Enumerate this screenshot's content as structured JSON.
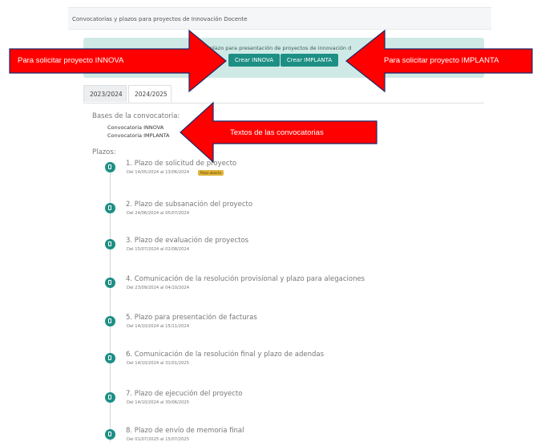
{
  "header": {
    "title": "Convocatorias y plazos para proyectos de Innovación Docente"
  },
  "notice": {
    "text": "el plazo para presentación de proyectos de innovación d",
    "btn_innova": "Crear INNOVA",
    "btn_implanta": "Crear IMPLANTA"
  },
  "tabs": [
    {
      "label": "2023/2024"
    },
    {
      "label": "2024/2025"
    }
  ],
  "bases": {
    "label": "Bases de la convocatoria:",
    "links": [
      "Convocatoria INNOVA",
      "Convocatoria IMPLANTA"
    ]
  },
  "plazos": {
    "label": "Plazos:",
    "badge": "Plazo abierto",
    "steps": [
      {
        "title": "1. Plazo de solicitud de proyecto",
        "dates": "Del 14/05/2024 al 13/06/2024"
      },
      {
        "title": "2. Plazo de subsanación del proyecto",
        "dates": "Del 24/06/2024 al 05/07/2024"
      },
      {
        "title": "3. Plazo de evaluación de proyectos",
        "dates": "Del 15/07/2024 al 02/08/2024"
      },
      {
        "title": "4. Comunicación de la resolución provisional y plazo para alegaciones",
        "dates": "Del 23/09/2024 al 04/10/2024"
      },
      {
        "title": "5. Plazo para presentación de facturas",
        "dates": "Del 14/10/2024 al 15/11/2024"
      },
      {
        "title": "6. Comunicación de la resolución final y plazo de adendas",
        "dates": "Del 14/10/2024 al 31/01/2025"
      },
      {
        "title": "7. Plazo de ejecución del proyecto",
        "dates": "Del 14/10/2024 al 30/06/2025"
      },
      {
        "title": "8. Plazo de envío de memoria final",
        "dates": "Del 01/07/2025 al 15/07/2025"
      }
    ]
  },
  "annotations": {
    "left": "Para solicitar proyecto INNOVA",
    "right": "Para solicitar proyecto IMPLANTA",
    "middle": "Textos de las convocatorias"
  },
  "colors": {
    "primary": "#1d8f84",
    "notice_bg": "#cfeae6",
    "annotation": "#ff0000",
    "badge": "#e0b33a"
  }
}
